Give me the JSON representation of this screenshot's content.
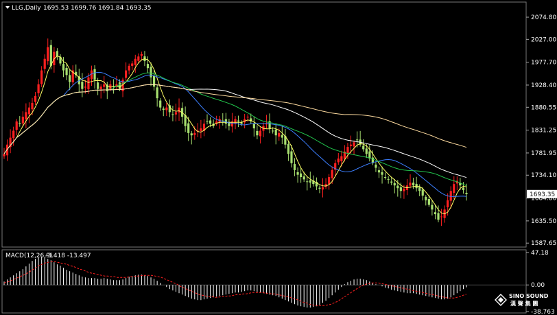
{
  "header": {
    "symbol": "LLG,Daily",
    "ohlc": "1695.53 1699.76 1691.84 1693.35",
    "macd_label": "MACD(12,26,9)",
    "macd_values": "-3.418 -13.497"
  },
  "logo": {
    "text": "SINO SOUND",
    "subtext": "漢 聲 集 團"
  },
  "colors": {
    "background": "#000000",
    "bull": "#ff2020",
    "bear": "#a8e070",
    "ma_fast": "#ffff66",
    "ma_mid": "#3c7fff",
    "ma_green": "#22c44c",
    "ma_slow": "#ffffff",
    "ma_slowest": "#ffdca0",
    "macd_hist": "#ffffff",
    "macd_signal": "#ff2020",
    "axis": "#aaaaaa"
  },
  "chart_data": [
    {
      "type": "candlestick",
      "title": "LLG,Daily",
      "ylim": [
        1585.0,
        2100.0
      ],
      "y_ticks": [
        "2074.80",
        "2027.00",
        "1977.70",
        "1928.40",
        "1880.55",
        "1831.25",
        "1781.95",
        "1734.10",
        "1684.80",
        "1635.50",
        "1587.65"
      ],
      "last_price_label": "1693.35",
      "last_price": 1693.35,
      "close": [
        1780,
        1800,
        1815,
        1830,
        1850,
        1845,
        1860,
        1870,
        1880,
        1890,
        1905,
        1930,
        1960,
        1985,
        2010,
        1970,
        2000,
        1990,
        1975,
        1960,
        1950,
        1935,
        1960,
        1950,
        1930,
        1920,
        1925,
        1945,
        1960,
        1940,
        1920,
        1925,
        1930,
        1915,
        1930,
        1925,
        1930,
        1920,
        1940,
        1960,
        1970,
        1975,
        1985,
        1990,
        1995,
        1980,
        1965,
        1945,
        1925,
        1900,
        1880,
        1875,
        1880,
        1870,
        1865,
        1870,
        1880,
        1860,
        1840,
        1825,
        1820,
        1825,
        1830,
        1835,
        1845,
        1850,
        1845,
        1840,
        1850,
        1855,
        1850,
        1845,
        1840,
        1850,
        1855,
        1850,
        1845,
        1855,
        1860,
        1850,
        1835,
        1820,
        1830,
        1840,
        1845,
        1835,
        1830,
        1820,
        1825,
        1815,
        1800,
        1780,
        1760,
        1745,
        1735,
        1730,
        1725,
        1720,
        1718,
        1715,
        1710,
        1705,
        1708,
        1715,
        1730,
        1745,
        1760,
        1770,
        1775,
        1785,
        1795,
        1800,
        1805,
        1810,
        1800,
        1790,
        1780,
        1770,
        1760,
        1750,
        1740,
        1735,
        1730,
        1725,
        1718,
        1712,
        1706,
        1700,
        1705,
        1712,
        1718,
        1712,
        1706,
        1700,
        1690,
        1680,
        1670,
        1660,
        1650,
        1638,
        1645,
        1660,
        1680,
        1700,
        1715,
        1722,
        1712,
        1702,
        1693.35
      ],
      "series": [
        {
          "name": "MA fast",
          "color_key": "ma_fast"
        },
        {
          "name": "MA mid",
          "color_key": "ma_mid"
        },
        {
          "name": "MA green",
          "color_key": "ma_green"
        },
        {
          "name": "MA slow",
          "color_key": "ma_slow"
        },
        {
          "name": "MA slowest",
          "color_key": "ma_slowest"
        }
      ]
    },
    {
      "type": "bar",
      "title": "MACD(12,26,9)",
      "ylim": [
        -38.763,
        47.18
      ],
      "y_ticks": [
        "47.18",
        "0.00",
        "-38.763"
      ],
      "values": [
        5,
        8,
        11,
        14,
        17,
        20,
        23,
        27,
        31,
        35,
        38,
        40,
        41,
        40,
        38,
        36,
        33,
        30,
        28,
        25,
        22,
        20,
        18,
        16,
        14,
        12,
        11,
        10,
        10,
        10,
        9,
        9,
        10,
        9,
        8,
        7,
        7,
        7,
        8,
        10,
        12,
        13,
        14,
        15,
        15,
        14,
        13,
        11,
        9,
        6,
        3,
        0,
        -3,
        -6,
        -8,
        -10,
        -12,
        -14,
        -16,
        -18,
        -20,
        -21,
        -22,
        -22,
        -21,
        -20,
        -19,
        -18,
        -17,
        -16,
        -15,
        -14,
        -13,
        -12,
        -11,
        -11,
        -10,
        -9,
        -8,
        -8,
        -9,
        -10,
        -11,
        -12,
        -13,
        -14,
        -15,
        -16,
        -18,
        -20,
        -22,
        -24,
        -26,
        -28,
        -30,
        -31,
        -32,
        -33,
        -33,
        -32,
        -31,
        -29,
        -26,
        -23,
        -19,
        -15,
        -11,
        -7,
        -3,
        1,
        4,
        6,
        8,
        9,
        9,
        8,
        7,
        5,
        3,
        1,
        0,
        -2,
        -4,
        -5,
        -7,
        -8,
        -9,
        -10,
        -11,
        -12,
        -12,
        -12,
        -13,
        -14,
        -15,
        -16,
        -17,
        -18,
        -19,
        -20,
        -21,
        -21,
        -20,
        -18,
        -15,
        -12,
        -9,
        -6,
        -3.418
      ],
      "signal": [
        3,
        4,
        6,
        8,
        10,
        12,
        14,
        16,
        19,
        22,
        25,
        28,
        30,
        32,
        33,
        34,
        34,
        33,
        32,
        31,
        30,
        28,
        27,
        25,
        23,
        22,
        20,
        18,
        17,
        16,
        15,
        14,
        13,
        13,
        12,
        12,
        11,
        11,
        11,
        11,
        12,
        12,
        13,
        13,
        14,
        14,
        14,
        14,
        13,
        12,
        11,
        9,
        7,
        5,
        3,
        1,
        -2,
        -4,
        -6,
        -8,
        -10,
        -12,
        -14,
        -15,
        -16,
        -17,
        -17,
        -18,
        -18,
        -17,
        -17,
        -16,
        -16,
        -15,
        -14,
        -14,
        -13,
        -13,
        -12,
        -11,
        -11,
        -11,
        -11,
        -12,
        -12,
        -13,
        -13,
        -14,
        -15,
        -16,
        -17,
        -18,
        -20,
        -21,
        -23,
        -25,
        -26,
        -28,
        -29,
        -30,
        -30,
        -30,
        -30,
        -29,
        -28,
        -26,
        -24,
        -21,
        -18,
        -15,
        -12,
        -9,
        -6,
        -3,
        -1,
        1,
        2,
        3,
        3,
        3,
        2,
        1,
        0,
        -1,
        -2,
        -3,
        -4,
        -5,
        -6,
        -7,
        -8,
        -9,
        -10,
        -11,
        -12,
        -13,
        -14,
        -15,
        -16,
        -17,
        -18,
        -19,
        -19,
        -19,
        -18,
        -17,
        -15,
        -13.497
      ],
      "series": [
        {
          "name": "MACD histogram",
          "color_key": "macd_hist"
        },
        {
          "name": "Signal",
          "color_key": "macd_signal"
        }
      ]
    }
  ]
}
